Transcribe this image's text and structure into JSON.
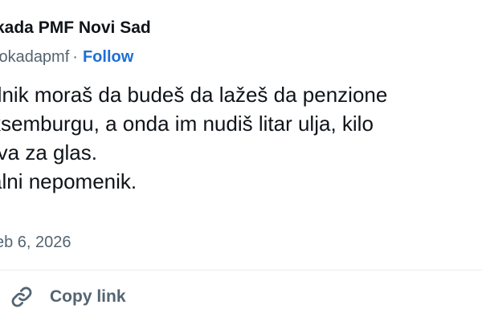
{
  "author": {
    "name": "kada PMF Novi Sad",
    "handle": "lokadapmf",
    "separator": "·",
    "follow_label": "Follow"
  },
  "tweet": {
    "lines": [
      "dnik moraš da budeš da lažeš da penzione",
      "ksemburgu, a onda im nudiš litar ulja, kilo",
      "rva za glas.",
      "alni nepomenik."
    ],
    "timestamp": "eb 6, 2026"
  },
  "actions": {
    "copy_link_label": "Copy link",
    "copy_link_icon": "link-icon"
  },
  "colors": {
    "text": "#0f1419",
    "secondary": "#536471",
    "link": "#1d6fd6"
  }
}
